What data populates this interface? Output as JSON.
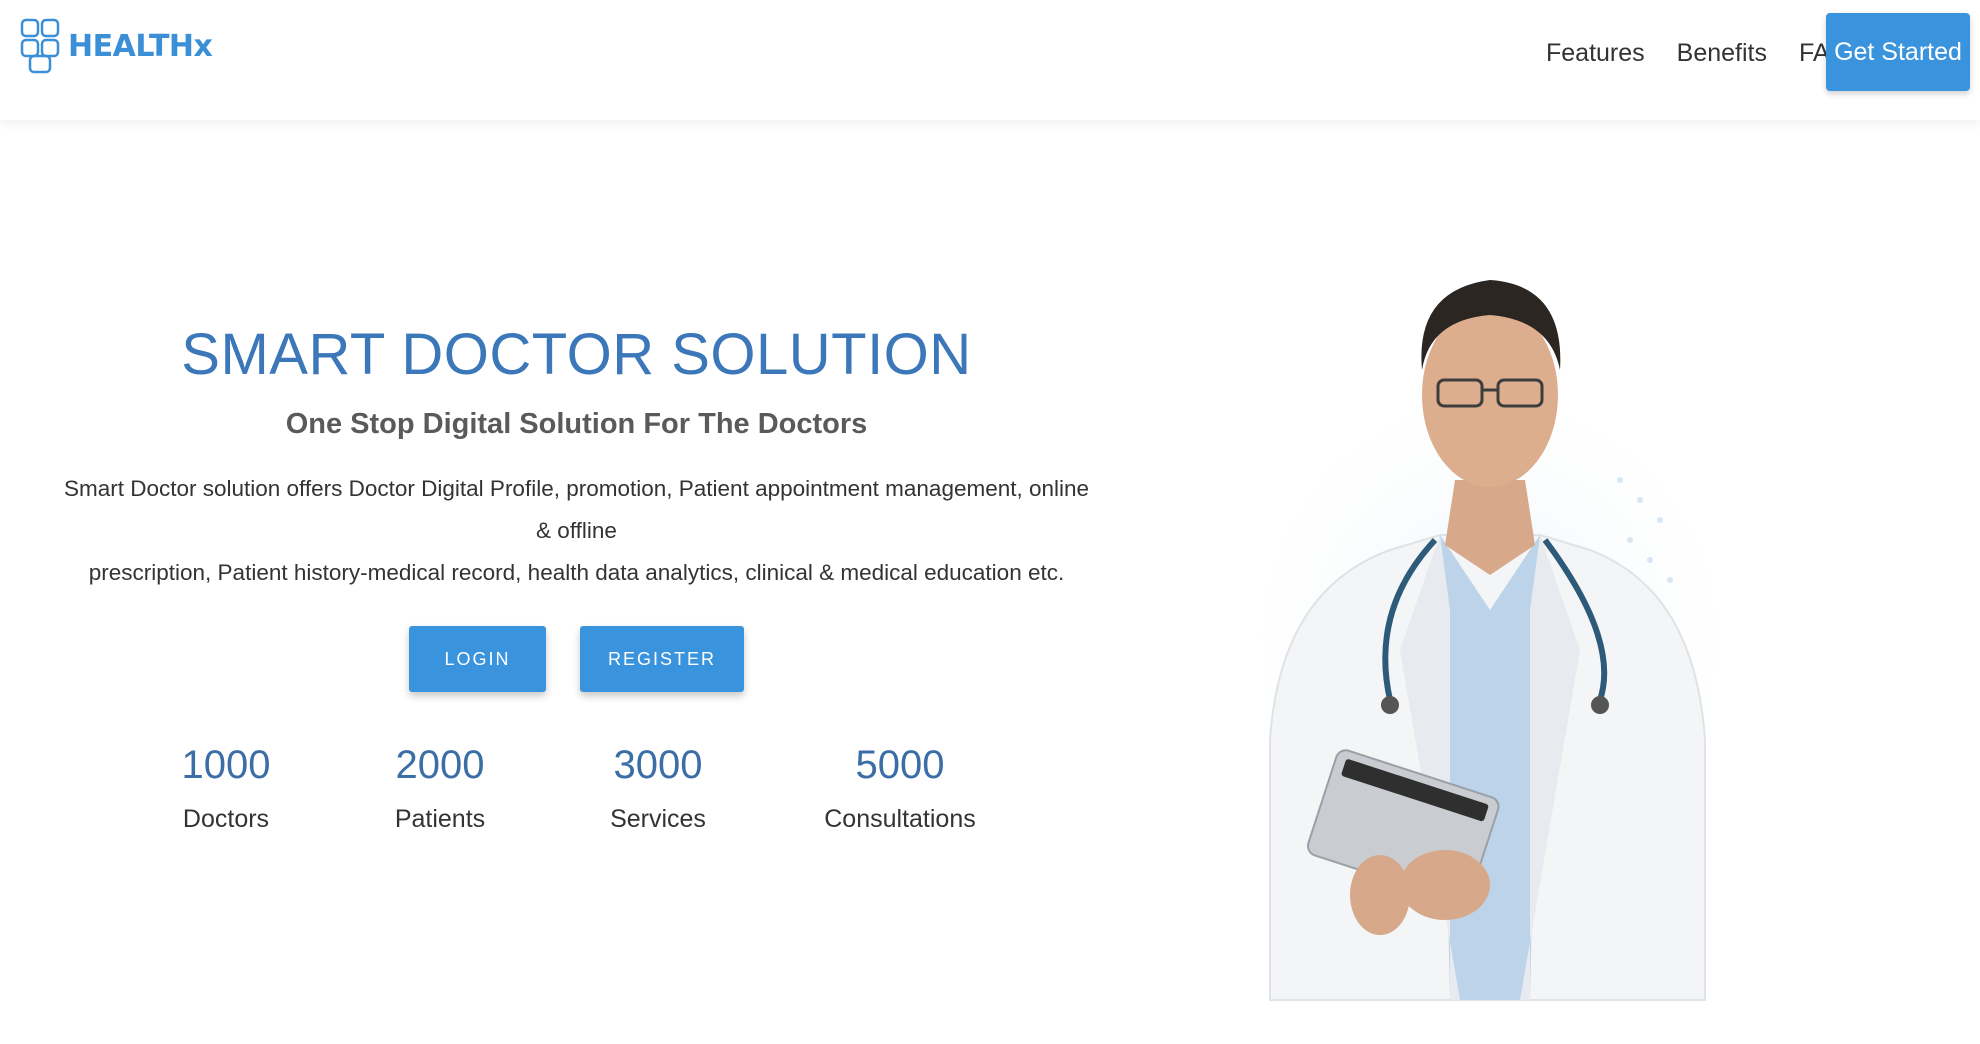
{
  "brand": {
    "name": "HEALTHx",
    "color": "#3a8fd6"
  },
  "nav": {
    "links": [
      "Features",
      "Benefits",
      "FAQ"
    ],
    "cta": "Get Started"
  },
  "hero": {
    "title": "SMART DOCTOR SOLUTION",
    "subtitle": "One Stop Digital Solution For The Doctors",
    "description_line1": "Smart Doctor solution offers Doctor Digital Profile, promotion, Patient appointment management, online & offline",
    "description_line2": "prescription, Patient history-medical record, health data analytics, clinical & medical education etc.",
    "login_label": "LOGIN",
    "register_label": "REGISTER",
    "image_icon": "doctor-photo"
  },
  "stats": [
    {
      "value": "1000",
      "label": "Doctors"
    },
    {
      "value": "2000",
      "label": "Patients"
    },
    {
      "value": "3000",
      "label": "Services"
    },
    {
      "value": "5000",
      "label": "Consultations"
    }
  ],
  "colors": {
    "accent": "#3a93dd",
    "title": "#3b77b9",
    "stat_value": "#3b6ea6"
  }
}
